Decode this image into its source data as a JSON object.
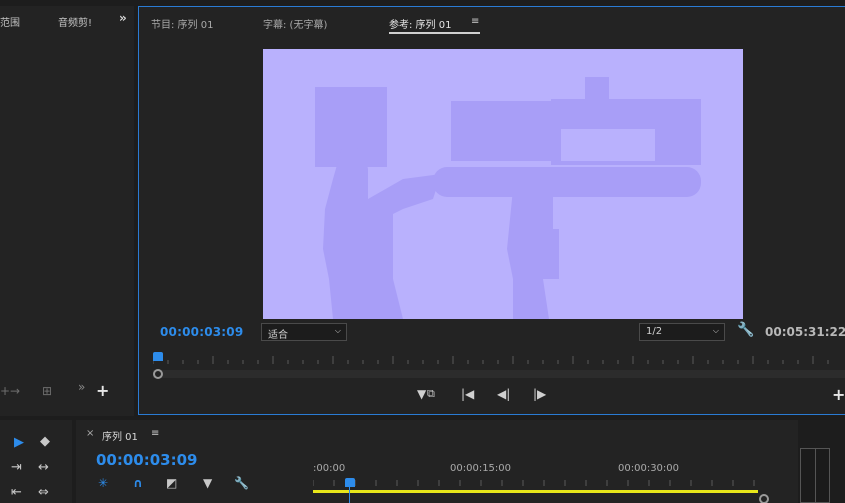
{
  "project_panel": {
    "tab_a": "范围",
    "tab_b": "音频剪!",
    "overflow": "»",
    "footer_icon_a": "+→",
    "footer_icon_b": "⊞",
    "footer_overflow": "»",
    "add_label": "+"
  },
  "program_monitor": {
    "tabs": [
      {
        "label": "节目: 序列 01",
        "active": false
      },
      {
        "label": "字幕: (无字幕)",
        "active": false
      },
      {
        "label": "参考: 序列 01",
        "active": true
      }
    ],
    "tab_menu": "≡",
    "timecode_current": "00:00:03:09",
    "fit_value": "适合",
    "resolution_value": "1/2",
    "timecode_duration": "00:05:31:22",
    "transport": {
      "marker": "▼",
      "go_in": "|◀",
      "step_back": "◀|",
      "step_forward": "|▶"
    },
    "add_label": "+"
  },
  "tools": {
    "select": "▶",
    "track_select": "◆",
    "ripple": "⇥",
    "rate": "↔",
    "razor": "⇤",
    "slip": "⇔"
  },
  "timeline": {
    "close": "×",
    "title": "序列 01",
    "menu": "≡",
    "timecode": "00:00:03:09",
    "ruler_labels": [
      ":00:00",
      "00:00:15:00",
      "00:00:30:00"
    ],
    "tool_icons": [
      "✳",
      "∩",
      "◩",
      "▼",
      "🔧"
    ]
  },
  "colors": {
    "accent_blue": "#2d8ceb",
    "video_bg": "#b9b1fd",
    "video_shape": "#a89ef7",
    "work_area_yellow": "#e8e61a"
  }
}
